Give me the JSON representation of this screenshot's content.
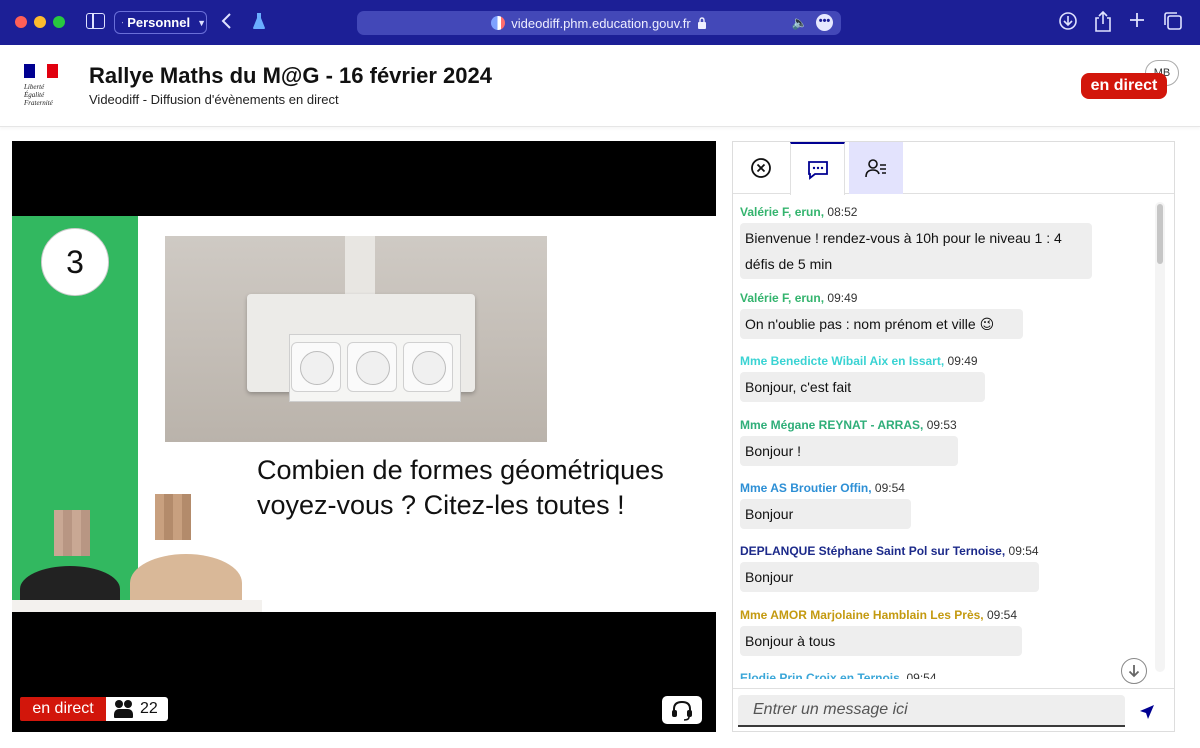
{
  "browser": {
    "profile_label": "Personnel",
    "url": "videodiff.phm.education.gouv.fr"
  },
  "header": {
    "logo_text": "Liberté\nÉgalité\nFraternité",
    "title": "Rallye Maths du M@G - 16 février 2024",
    "subtitle": "Videodiff - Diffusion d'évènements en direct",
    "live_label": "en direct",
    "user_initials": "MB",
    "colors": {
      "brand_blue": "#000091",
      "live_red": "#d2160b"
    }
  },
  "video": {
    "slide_number": "3",
    "question_line1": "Combien de formes géométriques",
    "question_line2": "voyez-vous ? Citez-les toutes !",
    "live_label": "en direct",
    "viewer_count": "22",
    "slide_accent": "#32b860"
  },
  "chat": {
    "messages": [
      {
        "author": "Valérie F, erun,",
        "time": "08:52",
        "text": "Bienvenue ! rendez-vous à 10h pour le niveau 1 : 4 défis de 5 min",
        "color": "#34b46e"
      },
      {
        "author": "Valérie F, erun,",
        "time": "09:49",
        "text": "On n'oublie pas : nom prénom et ville 😉",
        "color": "#34b46e"
      },
      {
        "author": "Mme Benedicte Wibail Aix en Issart,",
        "time": "09:49",
        "text": "Bonjour, c'est fait",
        "color": "#3ad3d3"
      },
      {
        "author": "Mme Mégane REYNAT - ARRAS,",
        "time": "09:53",
        "text": "Bonjour !",
        "color": "#2fae79"
      },
      {
        "author": "Mme AS Broutier Offin,",
        "time": "09:54",
        "text": "Bonjour",
        "color": "#2d8fd5"
      },
      {
        "author": "DEPLANQUE Stéphane Saint Pol sur Ternoise,",
        "time": "09:54",
        "text": "Bonjour",
        "color": "#1c2a8a"
      },
      {
        "author": "Mme AMOR Marjolaine Hamblain Les Près,",
        "time": "09:54",
        "text": "Bonjour à tous",
        "color": "#c49a10"
      },
      {
        "author": "Elodie Prin Croix en Ternois,",
        "time": "09:54",
        "text": "",
        "color": "#3aa6d8"
      }
    ],
    "input_placeholder": "Entrer un message ici"
  }
}
